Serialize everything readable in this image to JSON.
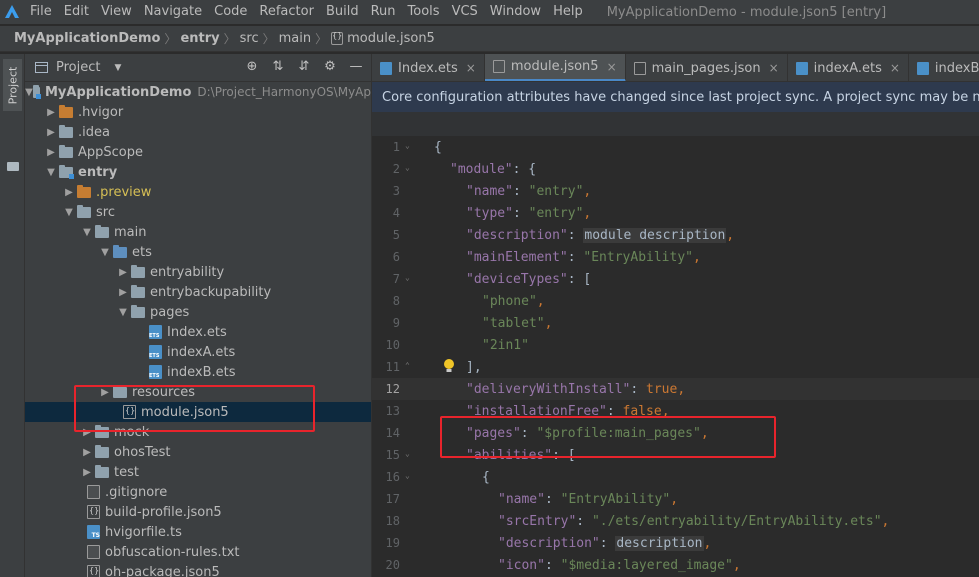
{
  "menubar": {
    "items": [
      "File",
      "Edit",
      "View",
      "Navigate",
      "Code",
      "Refactor",
      "Build",
      "Run",
      "Tools",
      "VCS",
      "Window",
      "Help"
    ],
    "window_title": "MyApplicationDemo - module.json5 [entry]"
  },
  "breadcrumb": {
    "items": [
      "MyApplicationDemo",
      "entry",
      "src",
      "main",
      "module.json5"
    ]
  },
  "toolstrip": {
    "project_tab": "Project"
  },
  "project_panel": {
    "title": "Project",
    "tree": [
      {
        "label": "MyApplicationDemo",
        "hint": "D:\\Project_HarmonyOS\\MyAp"
      },
      {
        "label": ".hvigor"
      },
      {
        "label": ".idea"
      },
      {
        "label": "AppScope"
      },
      {
        "label": "entry"
      },
      {
        "label": ".preview"
      },
      {
        "label": "src"
      },
      {
        "label": "main"
      },
      {
        "label": "ets"
      },
      {
        "label": "entryability"
      },
      {
        "label": "entrybackupability"
      },
      {
        "label": "pages"
      },
      {
        "label": "Index.ets"
      },
      {
        "label": "indexA.ets"
      },
      {
        "label": "indexB.ets"
      },
      {
        "label": "resources"
      },
      {
        "label": "module.json5"
      },
      {
        "label": "mock"
      },
      {
        "label": "ohosTest"
      },
      {
        "label": "test"
      },
      {
        "label": ".gitignore"
      },
      {
        "label": "build-profile.json5"
      },
      {
        "label": "hvigorfile.ts"
      },
      {
        "label": "obfuscation-rules.txt"
      },
      {
        "label": "oh-package.json5"
      }
    ]
  },
  "editor": {
    "tabs": [
      {
        "label": "Index.ets"
      },
      {
        "label": "module.json5"
      },
      {
        "label": "main_pages.json"
      },
      {
        "label": "indexA.ets"
      },
      {
        "label": "indexB.ets"
      }
    ],
    "notice": "Core configuration attributes have changed since last project sync. A project sync may be necessary fo",
    "line_numbers": [
      "1",
      "2",
      "3",
      "4",
      "5",
      "6",
      "7",
      "8",
      "9",
      "10",
      "11",
      "12",
      "13",
      "14",
      "15",
      "16",
      "17",
      "18",
      "19",
      "20"
    ],
    "code": {
      "l1": "{",
      "l2_key": "\"module\"",
      "l2_rest": ": {",
      "l3_key": "\"name\"",
      "l3_val": "\"entry\"",
      "l4_key": "\"type\"",
      "l4_val": "\"entry\"",
      "l5_key": "\"description\"",
      "l5_val": "module description",
      "l6_key": "\"mainElement\"",
      "l6_val": "\"EntryAbility\"",
      "l7_key": "\"deviceTypes\"",
      "l7_rest": ": [",
      "l8_val": "\"phone\"",
      "l9_val": "\"tablet\"",
      "l10_val": "\"2in1\"",
      "l11": "],",
      "l12_key": "\"deliveryWithInstall\"",
      "l12_val": "true",
      "l13_key": "\"installationFree\"",
      "l13_val": "false",
      "l14_key": "\"pages\"",
      "l14_val": "\"$profile:main_pages\"",
      "l15_key": "\"abilities\"",
      "l15_rest": ": [",
      "l16": "{",
      "l17_key": "\"name\"",
      "l17_val": "\"EntryAbility\"",
      "l18_key": "\"srcEntry\"",
      "l18_val": "\"./ets/entryability/EntryAbility.ets\"",
      "l19_key": "\"description\"",
      "l19_val": "description",
      "l20_key": "\"icon\"",
      "l20_val": "\"$media:layered_image\""
    }
  },
  "colors": {
    "highlight_box": "#e8242c",
    "key": "#9876aa",
    "string": "#6a8759",
    "keyword": "#cc7832",
    "selection": "#0d293e"
  }
}
